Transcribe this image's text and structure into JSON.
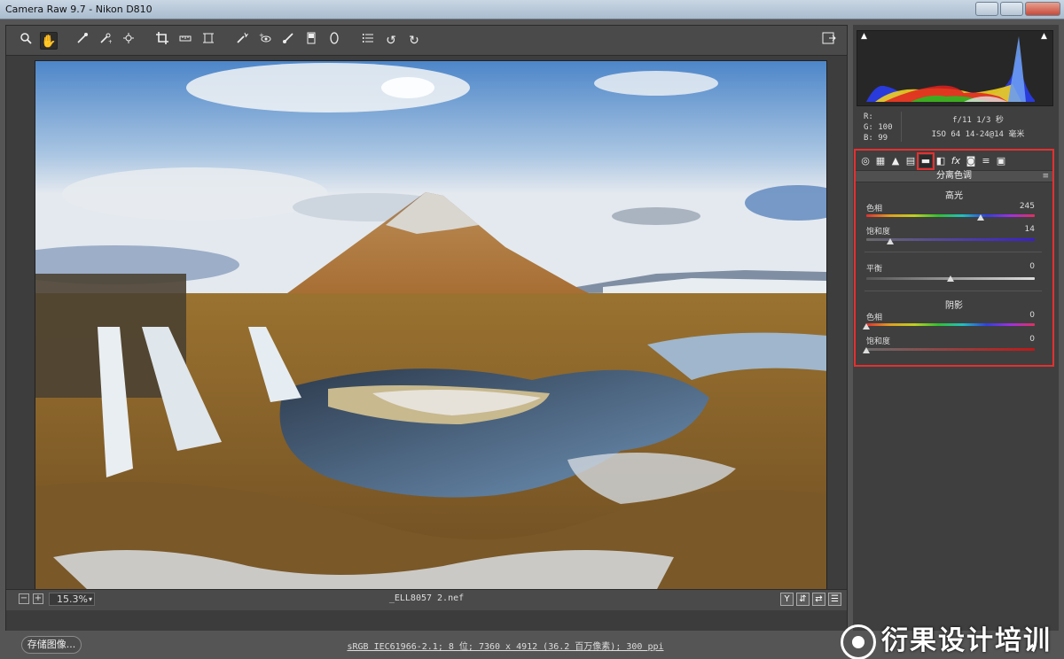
{
  "window": {
    "title": "Camera Raw 9.7 -  Nikon D810"
  },
  "toolbar": {
    "tools": [
      "zoom-icon",
      "hand-icon",
      "white-balance-icon",
      "color-sampler-icon",
      "targeted-adjustment-icon",
      "crop-icon",
      "straighten-icon",
      "transform-icon",
      "spot-removal-icon",
      "red-eye-icon",
      "adjustment-brush-icon",
      "graduated-filter-icon",
      "radial-filter-icon",
      "preferences-icon",
      "rotate-ccw-icon",
      "rotate-cw-icon"
    ],
    "fullscreen_icon": "fullscreen-icon"
  },
  "histogram": {
    "r": "R:",
    "g": "G: 100",
    "b": "B:  99"
  },
  "exif": {
    "line1": "f/11  1/3 秒",
    "line2": "ISO 64  14-24@14 毫米"
  },
  "panel": {
    "tabs": [
      "basic-icon",
      "tone-curve-icon",
      "detail-icon",
      "hsl-icon",
      "split-toning-icon",
      "lens-icon",
      "fx-icon",
      "camera-calibration-icon",
      "presets-icon",
      "snapshots-icon"
    ],
    "title": "分离色调",
    "highlights_label": "高光",
    "hl_hue_label": "色相",
    "hl_hue_value": "245",
    "hl_sat_label": "饱和度",
    "hl_sat_value": "14",
    "balance_label": "平衡",
    "balance_value": "0",
    "shadows_label": "阴影",
    "sh_hue_label": "色相",
    "sh_hue_value": "0",
    "sh_sat_label": "饱和度",
    "sh_sat_value": "0",
    "levels": {
      "hl_hue": 0.68,
      "hl_sat": 0.14,
      "balance": 0.5,
      "sh_hue": 0.0,
      "sh_sat": 0.0
    }
  },
  "statusbar": {
    "zoom": "15.3%",
    "filename": "_ELL8057 2.nef"
  },
  "bottom": {
    "save_label": "存储图像...",
    "workflow": "sRGB IEC61966-2.1; 8 位; 7360 x 4912 (36.2 百万像素); 300 ppi",
    "watermark": "衍果设计培训"
  },
  "colors": {
    "highlight_box": "#e53030",
    "panel_bg": "#3f3f3f"
  }
}
